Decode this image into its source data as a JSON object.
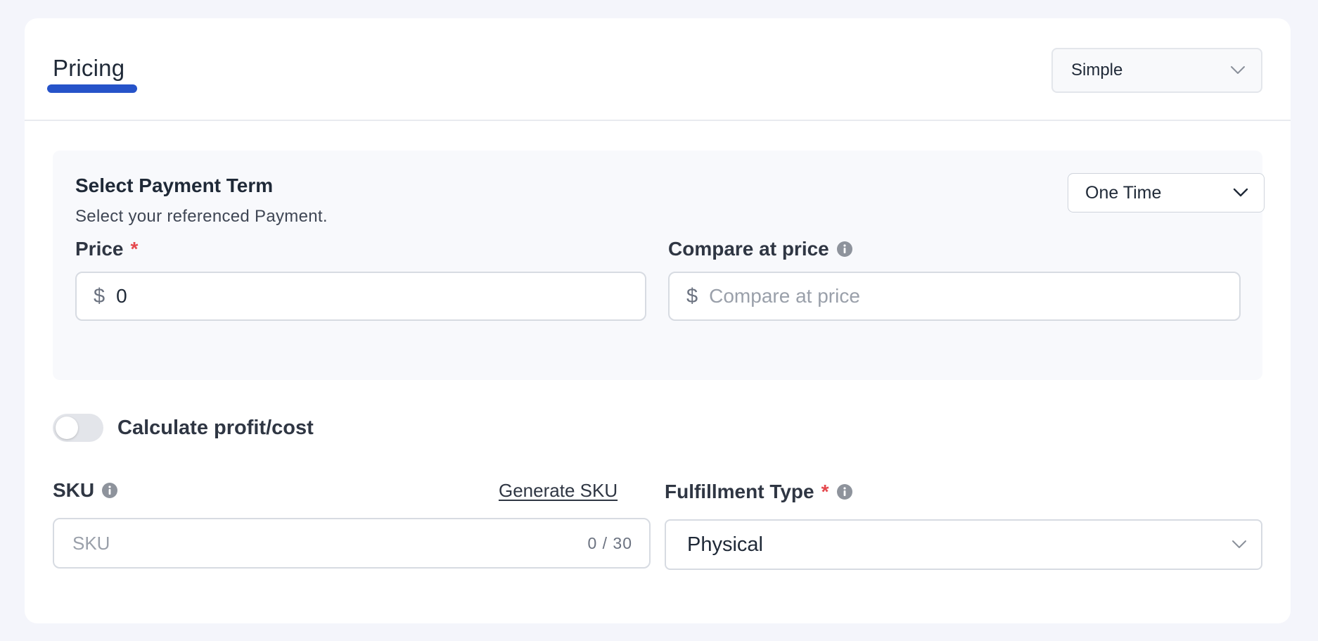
{
  "header": {
    "title": "Pricing",
    "type_select": {
      "value": "Simple"
    }
  },
  "payment_term": {
    "title": "Select Payment Term",
    "subtitle": "Select your referenced Payment.",
    "select_value": "One Time"
  },
  "price": {
    "label": "Price",
    "required_mark": "*",
    "currency_symbol": "$",
    "value": "0"
  },
  "compare_price": {
    "label": "Compare at price",
    "currency_symbol": "$",
    "placeholder": "Compare at price"
  },
  "profit_toggle": {
    "label": "Calculate profit/cost",
    "enabled": false
  },
  "sku": {
    "label": "SKU",
    "generate_label": "Generate SKU",
    "placeholder": "SKU",
    "counter": "0 / 30"
  },
  "fulfillment": {
    "label": "Fulfillment Type",
    "required_mark": "*",
    "value": "Physical"
  },
  "colors": {
    "accent": "#2653c9",
    "required": "#e5484d",
    "page_bg": "#f4f5fb",
    "card_bg": "#ffffff",
    "section_bg": "#f8f9fc"
  },
  "icons": {
    "chevron": "chevron-down-icon",
    "info": "info-icon"
  }
}
